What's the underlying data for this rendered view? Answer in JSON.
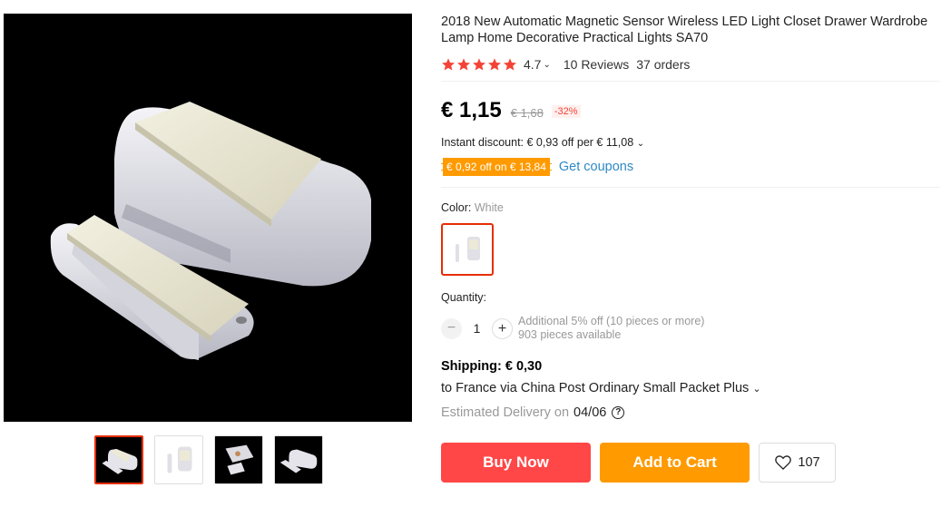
{
  "product": {
    "title": "2018 New Automatic Magnetic Sensor Wireless LED Light Closet Drawer Wardrobe Lamp Home Decorative Practical Lights SA70",
    "rating": {
      "stars": 5,
      "value": "4.7",
      "reviews_label": "10 Reviews",
      "orders_label": "37 orders",
      "star_color": "#f44336"
    },
    "price": {
      "current": "€ 1,15",
      "original": "€ 1,68",
      "discount_badge": "-32%"
    },
    "instant_discount": "Instant discount: € 0,93 off per € 11,08",
    "coupon": {
      "label": "€ 0,92 off on € 13,84",
      "link": "Get coupons"
    },
    "color": {
      "label": "Color:",
      "value": "White"
    },
    "quantity": {
      "label": "Quantity:",
      "value": "1",
      "minus": "−",
      "plus": "+",
      "note1": "Additional 5% off (10 pieces or more)",
      "note2": "903 pieces available"
    },
    "shipping": {
      "label": "Shipping: € 0,30",
      "via": "to France via China Post Ordinary Small Packet Plus",
      "estimated": "Estimated Delivery on",
      "date": "04/06"
    },
    "actions": {
      "buy_now": "Buy Now",
      "add_to_cart": "Add to Cart",
      "wishlist_count": "107"
    },
    "colors": {
      "accent_red": "#ff4747",
      "accent_orange": "#ff9a00",
      "link_blue": "#2f89c4"
    }
  },
  "gallery": {
    "thumbnails": [
      "thumb-1",
      "thumb-2",
      "thumb-3",
      "thumb-4"
    ],
    "active_index": 0
  }
}
